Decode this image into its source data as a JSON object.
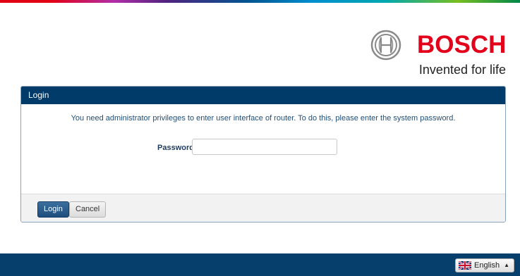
{
  "brand": {
    "wordmark": "BOSCH",
    "tagline": "Invented for life",
    "color": "#e2001a"
  },
  "login_panel": {
    "title": "Login",
    "message": "You need administrator privileges to enter user interface of router. To do this, please enter the system password.",
    "password_label": "Password",
    "password_value": "",
    "login_button": "Login",
    "cancel_button": "Cancel",
    "header_color": "#003b6a"
  },
  "footer": {
    "language": "English",
    "language_icon": "uk-flag-icon",
    "bar_color": "#063f6c"
  }
}
